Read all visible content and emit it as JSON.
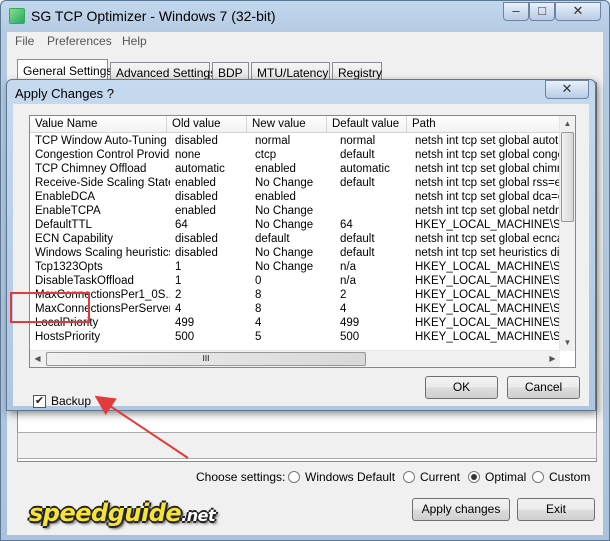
{
  "window": {
    "title": "SG TCP Optimizer - Windows 7 (32-bit)",
    "close_glyph": "✕"
  },
  "menu": [
    "File",
    "Preferences",
    "Help"
  ],
  "tabs": [
    "General Settings",
    "Advanced Settings",
    "BDP",
    "MTU/Latency",
    "Registry"
  ],
  "choose_label": "Choose settings:",
  "radios": [
    {
      "label": "Windows Default",
      "selected": false
    },
    {
      "label": "Current",
      "selected": false
    },
    {
      "label": "Optimal",
      "selected": true
    },
    {
      "label": "Custom",
      "selected": false
    }
  ],
  "buttons": {
    "apply": "Apply changes",
    "exit": "Exit"
  },
  "logo": {
    "main": "speedguide",
    "suffix": ".net"
  },
  "dialog": {
    "title": "Apply Changes ?",
    "close_glyph": "✕",
    "columns": [
      "Value Name",
      "Old value",
      "New value",
      "Default value",
      "Path"
    ],
    "rows": [
      [
        "TCP Window Auto-Tuning",
        "disabled",
        "normal",
        "normal",
        "netsh int tcp set global autotuni"
      ],
      [
        "Congestion Control Provider",
        "none",
        "ctcp",
        "default",
        "netsh int tcp set global congest"
      ],
      [
        "TCP Chimney Offload",
        "automatic",
        "enabled",
        "automatic",
        "netsh int tcp set global chimney"
      ],
      [
        "Receive-Side Scaling State",
        "enabled",
        "No Change",
        "default",
        "netsh int tcp set global rss=enal"
      ],
      [
        "EnableDCA",
        "disabled",
        "enabled",
        "",
        "netsh int tcp set global dca=ena"
      ],
      [
        "EnableTCPA",
        "enabled",
        "No Change",
        "",
        "netsh int tcp set global netdma="
      ],
      [
        "DefaultTTL",
        "64",
        "No Change",
        "64",
        "HKEY_LOCAL_MACHINE\\SYS"
      ],
      [
        "ECN Capability",
        "disabled",
        "default",
        "default",
        "netsh int tcp set global ecncapa"
      ],
      [
        "Windows Scaling heuristics",
        "disabled",
        "No Change",
        "default",
        "netsh int tcp set heuristics disab"
      ],
      [
        "Tcp1323Opts",
        "1",
        "No Change",
        "n/a",
        "HKEY_LOCAL_MACHINE\\SYS"
      ],
      [
        "DisableTaskOffload",
        "1",
        "0",
        "n/a",
        "HKEY_LOCAL_MACHINE\\SYS"
      ],
      [
        "MaxConnectionsPer1_0S...",
        "2",
        "8",
        "2",
        "HKEY_LOCAL_MACHINE\\SOF"
      ],
      [
        "MaxConnectionsPerServer",
        "4",
        "8",
        "4",
        "HKEY_LOCAL_MACHINE\\SOF"
      ],
      [
        "LocalPriority",
        "499",
        "4",
        "499",
        "HKEY_LOCAL_MACHINE\\SYS"
      ],
      [
        "HostsPriority",
        "500",
        "5",
        "500",
        "HKEY_LOCAL_MACHINE\\SYS"
      ]
    ],
    "backup_label": "Backup",
    "backup_checked": true,
    "ok_label": "OK",
    "cancel_label": "Cancel",
    "check_glyph": "✔",
    "hscroll_grip": "III"
  },
  "colors": {
    "annotation": "#e23b3b"
  }
}
